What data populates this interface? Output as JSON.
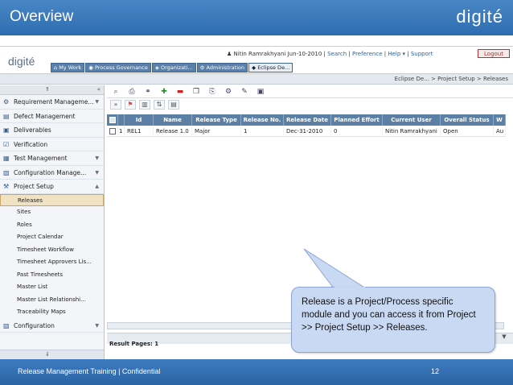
{
  "slide": {
    "title": "Overview",
    "logo": "digité",
    "footer": "Release Management Training |  Confidential",
    "page_number": "12"
  },
  "app": {
    "logo": "digité",
    "user": "Nitin Ramrakhyani",
    "date": "Jun-10-2010",
    "links": [
      "Search",
      "Preference",
      "Help ▾",
      "Support"
    ],
    "logout": "Logout",
    "tabs": [
      "My Work",
      "Process Governance",
      "Organizati...",
      "Administration",
      "Eclipse De..."
    ],
    "breadcrumb": "Eclipse De... > Project Setup > Releases"
  },
  "sidebar": {
    "groups": [
      {
        "label": "Requirement Manageme...",
        "icon": "requirement-icon"
      },
      {
        "label": "Defect Management",
        "icon": "defect-icon"
      },
      {
        "label": "Deliverables",
        "icon": "deliverables-icon"
      },
      {
        "label": "Verification",
        "icon": "verification-icon"
      },
      {
        "label": "Test Management",
        "icon": "test-icon"
      },
      {
        "label": "Configuration Manage...",
        "icon": "config-icon"
      },
      {
        "label": "Project Setup",
        "icon": "project-setup-icon"
      }
    ],
    "subitems": [
      "Releases",
      "Sites",
      "Roles",
      "Project Calendar",
      "Timesheet Workflow",
      "Timesheet Approvers Lis...",
      "Past Timesheets",
      "Master List",
      "Master List Relationshi...",
      "Traceability Maps"
    ],
    "bottom_group": "Configuration"
  },
  "grid": {
    "headers": [
      "Id",
      "Name",
      "Release Type",
      "Release No.",
      "Release Date",
      "Planned Effort",
      "Current User",
      "Overall Status",
      "W"
    ],
    "rows": [
      {
        "num": "1",
        "id": "REL1",
        "name": "Release 1.0",
        "type": "Major",
        "no": "1",
        "date": "Dec-31-2010",
        "effort": "0",
        "user": "Nitin Ramrakhyani",
        "status": "Open",
        "w": "Au"
      }
    ]
  },
  "result_pages": "Result Pages: 1",
  "callout": "Release is a Project/Process specific module and you can access it from Project >> Project Setup >> Releases."
}
